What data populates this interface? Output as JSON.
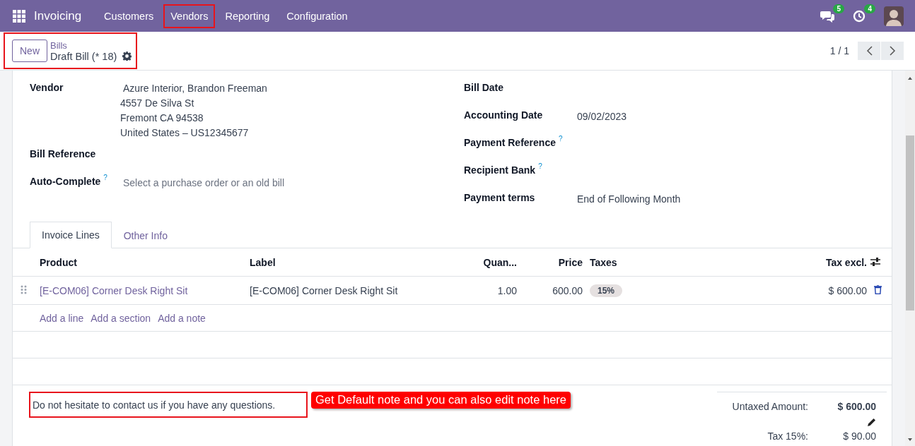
{
  "navbar": {
    "app": "Invoicing",
    "menus": [
      {
        "label": "Customers",
        "highlighted": false
      },
      {
        "label": "Vendors",
        "highlighted": true
      },
      {
        "label": "Reporting",
        "highlighted": false
      },
      {
        "label": "Configuration",
        "highlighted": false
      }
    ],
    "messages_badge": "5",
    "activities_badge": "4"
  },
  "control_panel": {
    "highlighted": true,
    "new_button": "New",
    "breadcrumb": "Bills",
    "record": "Draft Bill (* 18)",
    "pager": "1 / 1"
  },
  "form": {
    "left_fields": [
      {
        "label": "Vendor",
        "value_lines": [
          "Azure Interior, Brandon Freeman",
          "4557 De Silva St",
          "Fremont CA 94538",
          "United States – US12345677"
        ]
      },
      {
        "label": "Bill Reference"
      },
      {
        "label": "Auto-Complete",
        "help_mark": "?",
        "placeholder": "Select a purchase order or an old bill"
      }
    ],
    "right_fields": [
      {
        "label": "Bill Date"
      },
      {
        "label": "Accounting Date",
        "value": "09/02/2023"
      },
      {
        "label": "Payment Reference",
        "help_mark": "?"
      },
      {
        "label": "Recipient Bank",
        "help_mark": "?"
      },
      {
        "label": "Payment terms",
        "value": "End of Following Month"
      }
    ],
    "tabs": [
      {
        "label": "Invoice Lines",
        "selected": true
      },
      {
        "label": "Other Info",
        "selected": false
      }
    ],
    "table": {
      "columns": [
        "Product",
        "Label",
        "Quan...",
        "Price",
        "Taxes",
        "Tax excl."
      ],
      "rows": [
        {
          "product": "[E-COM06] Corner Desk Right Sit",
          "label": "[E-COM06] Corner Desk Right Sit",
          "quantity": "1.00",
          "price": "600.00",
          "taxes": "15%",
          "tax_excl": "$ 600.00"
        }
      ],
      "add_links": [
        "Add a line",
        "Add a section",
        "Add a note"
      ]
    },
    "note": {
      "text": "Do not hesitate to contact us if you have any questions.",
      "highlighted": true
    },
    "annotation": "Get Default note and you can also edit note here",
    "totals": [
      {
        "label": "Untaxed Amount:",
        "value": "$ 600.00",
        "kind": "bold"
      },
      {
        "label": "Tax 15%:",
        "value": "$ 90.00",
        "kind": "editable"
      }
    ]
  }
}
